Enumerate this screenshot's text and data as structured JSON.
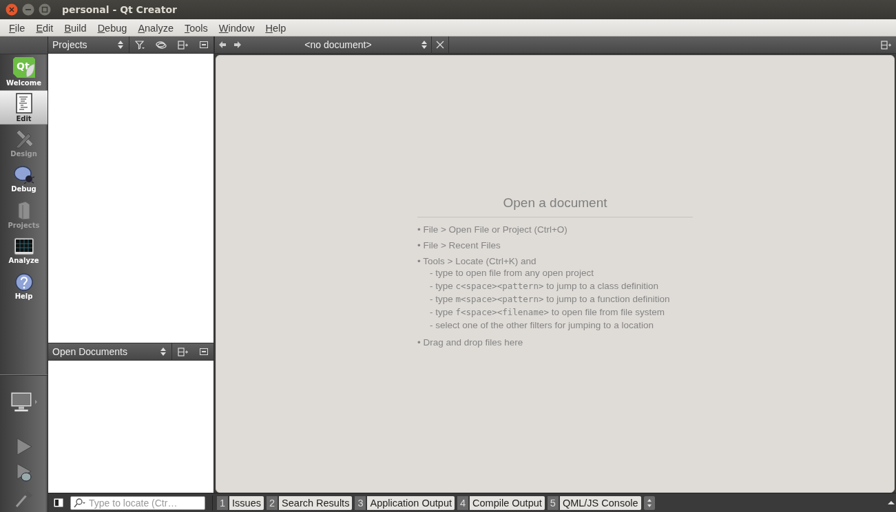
{
  "window": {
    "title": "personal - Qt Creator"
  },
  "menu": [
    "File",
    "Edit",
    "Build",
    "Debug",
    "Analyze",
    "Tools",
    "Window",
    "Help"
  ],
  "modes": [
    {
      "label": "Welcome",
      "kind": "welcome",
      "logo_text": "Qt",
      "selected": false,
      "disabled": false
    },
    {
      "label": "Edit",
      "kind": "edit",
      "selected": true,
      "disabled": false
    },
    {
      "label": "Design",
      "kind": "design",
      "selected": false,
      "disabled": true
    },
    {
      "label": "Debug",
      "kind": "debug",
      "selected": false,
      "disabled": false
    },
    {
      "label": "Projects",
      "kind": "projects",
      "selected": false,
      "disabled": true
    },
    {
      "label": "Analyze",
      "kind": "analyze",
      "selected": false,
      "disabled": false
    },
    {
      "label": "Help",
      "kind": "help",
      "selected": false,
      "disabled": false
    }
  ],
  "projects_pane": {
    "title": "Projects"
  },
  "documents_pane": {
    "title": "Open Documents"
  },
  "editor": {
    "document": "<no document>",
    "heading": "Open a document",
    "items": [
      {
        "text": "• File > Open File or Project (Ctrl+O)"
      },
      {
        "text": "• File > Recent Files"
      },
      {
        "text": "• Tools > Locate (Ctrl+K) and",
        "children": [
          {
            "text": "- type to open file from any open project"
          },
          {
            "before": "- type ",
            "code": "c<space><pattern>",
            "after": " to jump to a class definition"
          },
          {
            "before": "- type ",
            "code": "m<space><pattern>",
            "after": " to jump to a function definition"
          },
          {
            "before": "- type ",
            "code": "f<space><filename>",
            "after": " to open file from file system"
          },
          {
            "text": "- select one of the other filters for jumping to a location"
          }
        ]
      },
      {
        "text": "• Drag and drop files here"
      }
    ]
  },
  "locator": {
    "placeholder": "Type to locate (Ctr…"
  },
  "output_tabs": [
    {
      "number": "1",
      "label": "Issues"
    },
    {
      "number": "2",
      "label": "Search Results"
    },
    {
      "number": "3",
      "label": "Application Output"
    },
    {
      "number": "4",
      "label": "Compile Output"
    },
    {
      "number": "5",
      "label": "QML/JS Console"
    }
  ]
}
